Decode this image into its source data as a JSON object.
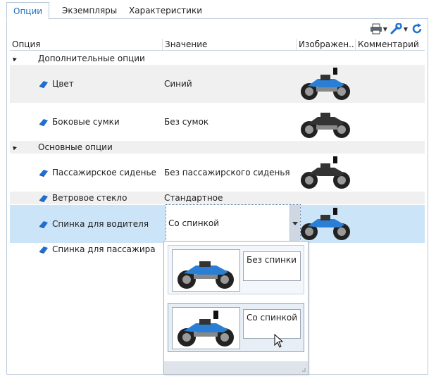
{
  "tabs": [
    {
      "label": "Опции",
      "active": true
    },
    {
      "label": "Экземпляры",
      "active": false
    },
    {
      "label": "Характеристики",
      "active": false
    }
  ],
  "toolbar": {
    "icons": [
      "printer-icon",
      "wrench-icon",
      "refresh-icon"
    ]
  },
  "columns": {
    "option": "Опция",
    "value": "Значение",
    "image": "Изображен...",
    "comment": "Комментарий"
  },
  "groups": {
    "additional": "Дополнительные опции",
    "main": "Основные опции"
  },
  "rows": [
    {
      "option": "Цвет",
      "value": "Синий"
    },
    {
      "option": "Боковые сумки",
      "value": "Без сумок"
    },
    {
      "option": "Пассажирское сиденье",
      "value": "Без пассажирского сиденья"
    },
    {
      "option": "Ветровое стекло",
      "value": "Стандартное"
    },
    {
      "option": "Спинка для водителя",
      "value": "Со спинкой"
    },
    {
      "option": "Спинка для пассажира",
      "value": ""
    }
  ],
  "dropdown": {
    "items": [
      {
        "label": "Без спинки"
      },
      {
        "label": "Со спинкой"
      }
    ]
  },
  "colors": {
    "accent": "#1f6fbf",
    "selected_row": "#cce4f7",
    "alt_row": "#f0f0f0",
    "icon_blue": "#1e6fd0"
  }
}
